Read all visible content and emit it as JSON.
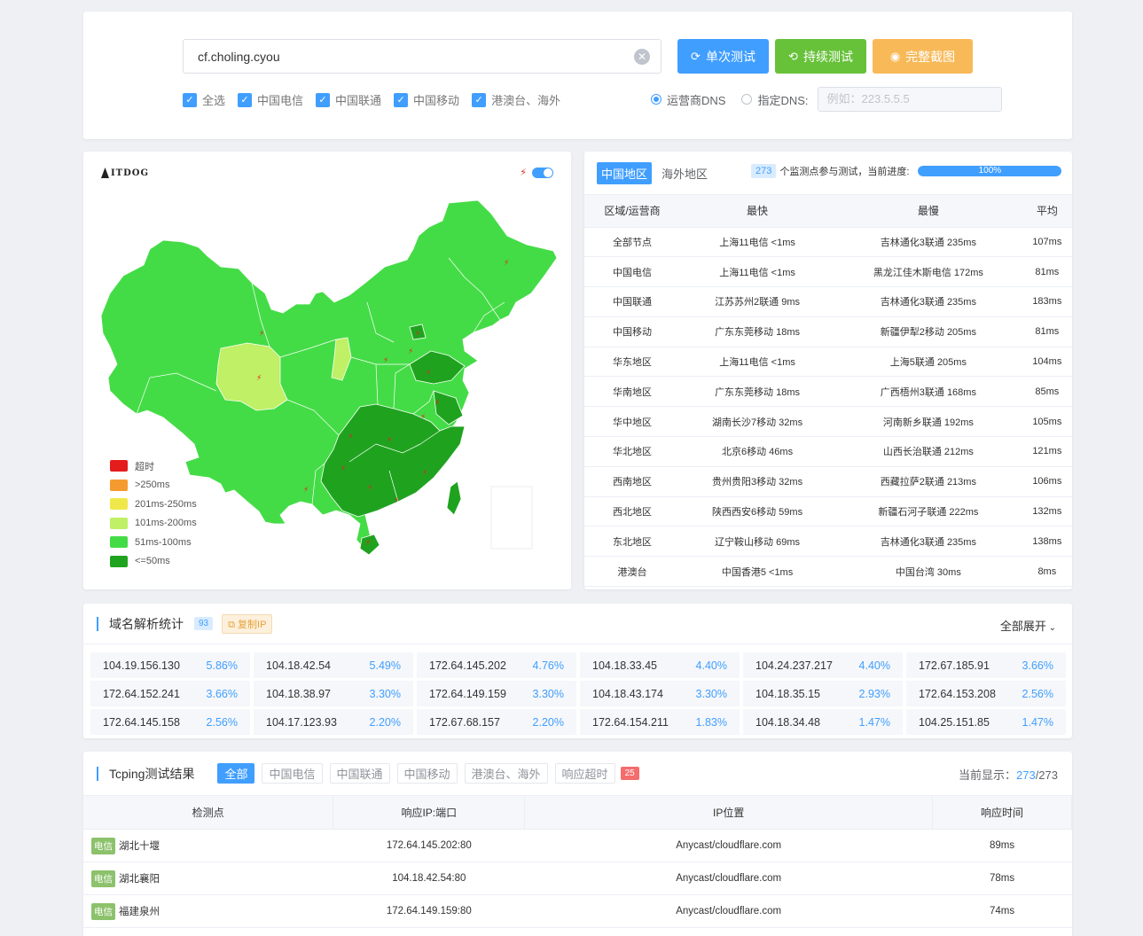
{
  "search": {
    "domain": "cf.choling.cyou",
    "btn_single": "单次测试",
    "btn_continuous": "持续测试",
    "btn_screenshot": "完整截图",
    "checks": [
      "全选",
      "中国电信",
      "中国联通",
      "中国移动",
      "港澳台、海外"
    ],
    "dns_isp": "运营商DNS",
    "dns_custom": "指定DNS:",
    "dns_placeholder": "例如：223.5.5.5"
  },
  "map": {
    "logo": "ITDOG",
    "legend": [
      {
        "label": "超时",
        "color": "#e51c1c"
      },
      {
        "label": ">250ms",
        "color": "#f59a2f"
      },
      {
        "label": "201ms-250ms",
        "color": "#f0e84a"
      },
      {
        "label": "101ms-200ms",
        "color": "#bff065"
      },
      {
        "label": "51ms-100ms",
        "color": "#44dc46"
      },
      {
        "label": "<=50ms",
        "color": "#1fa31f"
      }
    ]
  },
  "stats": {
    "tab_china": "中国地区",
    "tab_overseas": "海外地区",
    "node_count": "273",
    "node_text": "个监测点参与测试，当前进度:",
    "progress": "100%",
    "progress_value": 100,
    "headers": [
      "区域/运营商",
      "最快",
      "最慢",
      "平均"
    ],
    "rows": [
      [
        "全部节点",
        "上海11电信 <1ms",
        "吉林通化3联通 235ms",
        "107ms"
      ],
      [
        "中国电信",
        "上海11电信 <1ms",
        "黑龙江佳木斯电信 172ms",
        "81ms"
      ],
      [
        "中国联通",
        "江苏苏州2联通 9ms",
        "吉林通化3联通 235ms",
        "183ms"
      ],
      [
        "中国移动",
        "广东东莞移动 18ms",
        "新疆伊犁2移动 205ms",
        "81ms"
      ],
      [
        "华东地区",
        "上海11电信 <1ms",
        "上海5联通 205ms",
        "104ms"
      ],
      [
        "华南地区",
        "广东东莞移动 18ms",
        "广西梧州3联通 168ms",
        "85ms"
      ],
      [
        "华中地区",
        "湖南长沙7移动 32ms",
        "河南新乡联通 192ms",
        "105ms"
      ],
      [
        "华北地区",
        "北京6移动 46ms",
        "山西长治联通 212ms",
        "121ms"
      ],
      [
        "西南地区",
        "贵州贵阳3移动 32ms",
        "西藏拉萨2联通 213ms",
        "106ms"
      ],
      [
        "西北地区",
        "陕西西安6移动 59ms",
        "新疆石河子联通 222ms",
        "132ms"
      ],
      [
        "东北地区",
        "辽宁鞍山移动 69ms",
        "吉林通化3联通 235ms",
        "138ms"
      ],
      [
        "港澳台",
        "中国香港5 <1ms",
        "中国台湾 30ms",
        "8ms"
      ]
    ]
  },
  "dns_stats": {
    "title": "域名解析统计",
    "count": "93",
    "copy_label": "复制IP",
    "expand_label": "全部展开",
    "ips": [
      {
        "ip": "104.19.156.130",
        "pct": "5.86%"
      },
      {
        "ip": "104.18.42.54",
        "pct": "5.49%"
      },
      {
        "ip": "172.64.145.202",
        "pct": "4.76%"
      },
      {
        "ip": "104.18.33.45",
        "pct": "4.40%"
      },
      {
        "ip": "104.24.237.217",
        "pct": "4.40%"
      },
      {
        "ip": "172.67.185.91",
        "pct": "3.66%"
      },
      {
        "ip": "172.64.152.241",
        "pct": "3.66%"
      },
      {
        "ip": "104.18.38.97",
        "pct": "3.30%"
      },
      {
        "ip": "172.64.149.159",
        "pct": "3.30%"
      },
      {
        "ip": "104.18.43.174",
        "pct": "3.30%"
      },
      {
        "ip": "104.18.35.15",
        "pct": "2.93%"
      },
      {
        "ip": "172.64.153.208",
        "pct": "2.56%"
      },
      {
        "ip": "172.64.145.158",
        "pct": "2.56%"
      },
      {
        "ip": "104.17.123.93",
        "pct": "2.20%"
      },
      {
        "ip": "172.67.68.157",
        "pct": "2.20%"
      },
      {
        "ip": "172.64.154.211",
        "pct": "1.83%"
      },
      {
        "ip": "104.18.34.48",
        "pct": "1.47%"
      },
      {
        "ip": "104.25.151.85",
        "pct": "1.47%"
      }
    ]
  },
  "tcping": {
    "title": "Tcping测试结果",
    "filters": [
      "全部",
      "中国电信",
      "中国联通",
      "中国移动",
      "港澳台、海外",
      "响应超时"
    ],
    "timeout_count": "25",
    "shown_label": "当前显示：",
    "shown_num": "273",
    "shown_total": "/273",
    "headers": [
      "检测点",
      "响应IP:端口",
      "IP位置",
      "响应时间"
    ],
    "rows": [
      {
        "isp": "电信",
        "node": "湖北十堰",
        "ip": "172.64.145.202:80",
        "loc": "Anycast/cloudflare.com",
        "time": "89ms"
      },
      {
        "isp": "电信",
        "node": "湖北襄阳",
        "ip": "104.18.42.54:80",
        "loc": "Anycast/cloudflare.com",
        "time": "78ms"
      },
      {
        "isp": "电信",
        "node": "福建泉州",
        "ip": "172.64.149.159:80",
        "loc": "Anycast/cloudflare.com",
        "time": "74ms"
      },
      {
        "isp": "",
        "node": "",
        "ip": "",
        "loc": "",
        "time": ""
      }
    ]
  }
}
